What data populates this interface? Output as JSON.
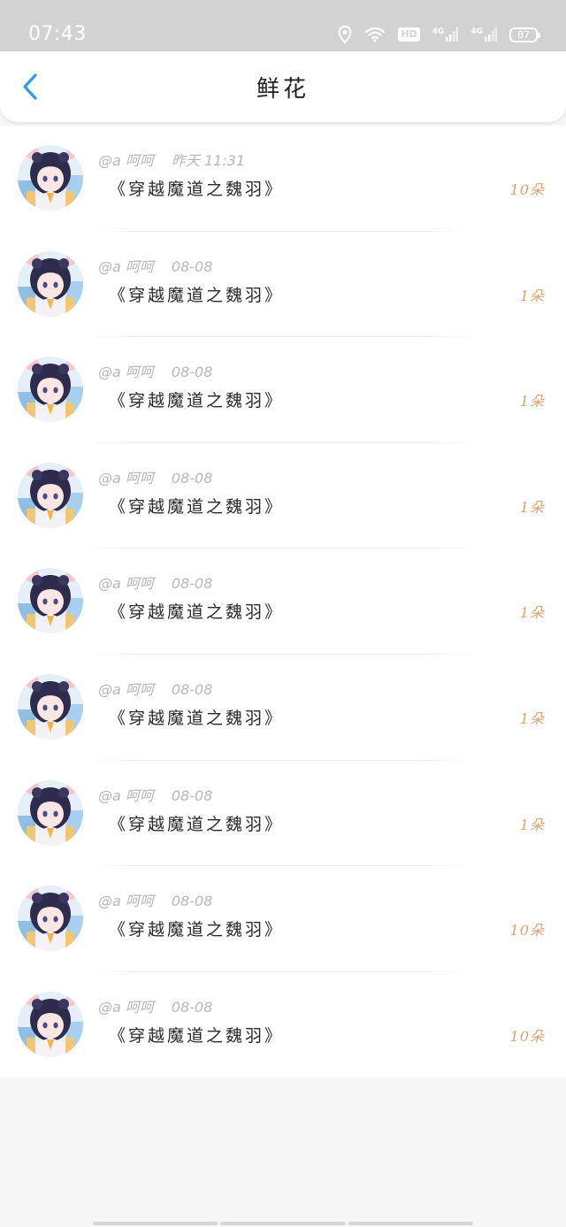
{
  "status_bar": {
    "time": "07:43",
    "hd_label": "HD",
    "net1_label": "4G",
    "net2_label": "4G",
    "battery": "87"
  },
  "header": {
    "title": "鲜花"
  },
  "colors": {
    "accent": "#2d9be8",
    "count": "#e1a06b",
    "meta": "#b7b7b7"
  },
  "items": [
    {
      "user": "@a 呵呵",
      "time": "昨天 11:31",
      "book": "《穿越魔道之魏羽》",
      "count": "10朵"
    },
    {
      "user": "@a 呵呵",
      "time": "08-08",
      "book": "《穿越魔道之魏羽》",
      "count": "1朵"
    },
    {
      "user": "@a 呵呵",
      "time": "08-08",
      "book": "《穿越魔道之魏羽》",
      "count": "1朵"
    },
    {
      "user": "@a 呵呵",
      "time": "08-08",
      "book": "《穿越魔道之魏羽》",
      "count": "1朵"
    },
    {
      "user": "@a 呵呵",
      "time": "08-08",
      "book": "《穿越魔道之魏羽》",
      "count": "1朵"
    },
    {
      "user": "@a 呵呵",
      "time": "08-08",
      "book": "《穿越魔道之魏羽》",
      "count": "1朵"
    },
    {
      "user": "@a 呵呵",
      "time": "08-08",
      "book": "《穿越魔道之魏羽》",
      "count": "1朵"
    },
    {
      "user": "@a 呵呵",
      "time": "08-08",
      "book": "《穿越魔道之魏羽》",
      "count": "10朵"
    },
    {
      "user": "@a 呵呵",
      "time": "08-08",
      "book": "《穿越魔道之魏羽》",
      "count": "10朵"
    }
  ]
}
